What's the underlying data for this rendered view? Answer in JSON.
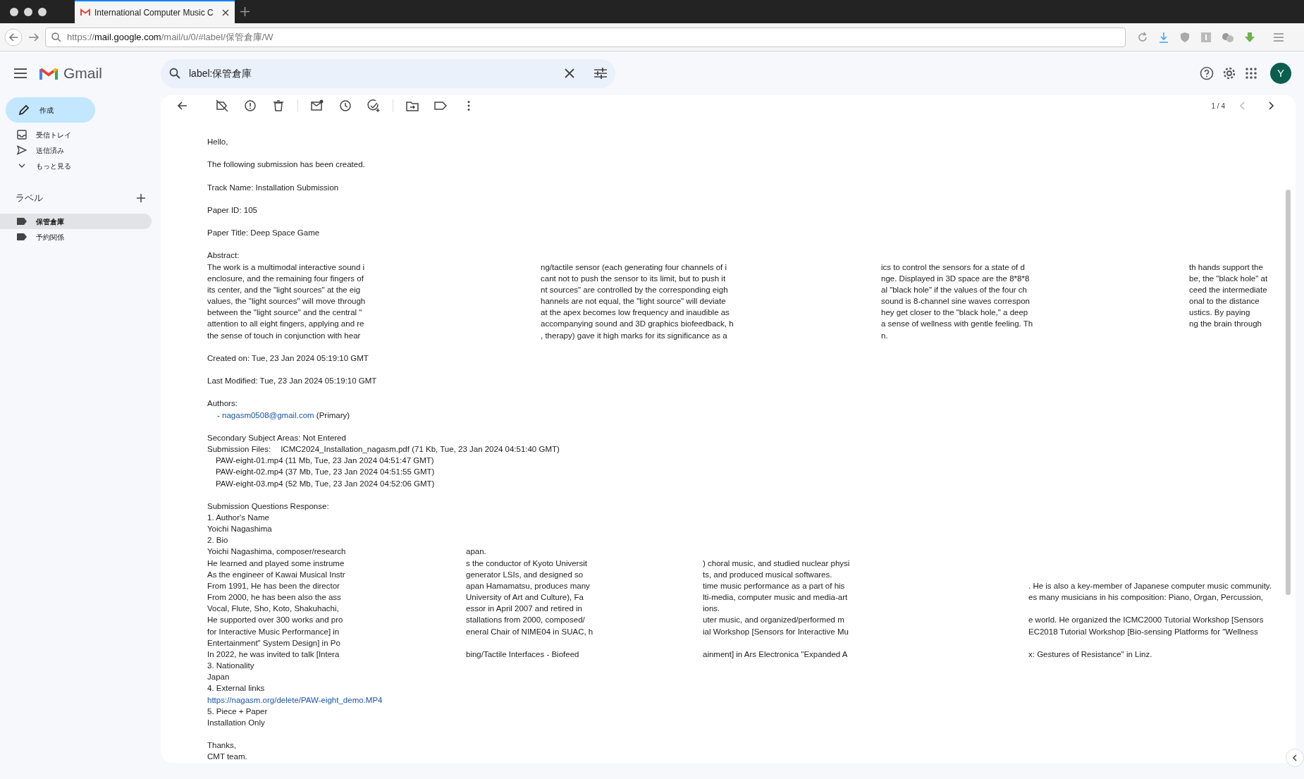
{
  "browser": {
    "tab_title": "International Computer Music C",
    "url": {
      "scheme": "https://",
      "host": "mail.google.com",
      "path": "/mail/u/0/#label/保管倉庫/W"
    }
  },
  "app": {
    "name": "Gmail",
    "search": {
      "value": "label:保管倉庫"
    },
    "avatar": "Y"
  },
  "sidebar": {
    "compose": "作成",
    "items": [
      {
        "label": "受信トレイ"
      },
      {
        "label": "送信済み"
      },
      {
        "label": "もっと見る"
      }
    ],
    "labels_heading": "ラベル",
    "labels": [
      {
        "label": "保管倉庫",
        "selected": true
      },
      {
        "label": "予約関係",
        "selected": false
      }
    ]
  },
  "toolbar": {
    "pagination": "1 / 4",
    "prev_disabled": true,
    "next_disabled": false
  },
  "message": {
    "paragraphs": [
      [
        {
          "kind": "text",
          "text": "Hello,"
        }
      ],
      [
        {
          "kind": "text",
          "text": "The following submission has been created."
        }
      ],
      [
        {
          "kind": "text",
          "text": "Track Name: Installation Submission"
        }
      ],
      [
        {
          "kind": "text",
          "text": "Paper ID: 105"
        }
      ],
      [
        {
          "kind": "text",
          "text": "Paper Title: Deep Space Game"
        }
      ],
      [
        {
          "kind": "text",
          "text": "Abstract:"
        },
        {
          "kind": "abstract_row",
          "cells": [
            "The work is a multimodal interactive sound i",
            "ng/tactile sensor (each generating four channels of i",
            "ics to control the sensors for a state of d",
            "th hands support the"
          ]
        },
        {
          "kind": "abstract_row",
          "cells": [
            "enclosure, and the remaining four fingers of",
            "cant not to push the sensor to its limit, but to push it",
            "nge. Displayed in 3D space are the 8*8*8",
            "be, the \"black hole\" at"
          ]
        },
        {
          "kind": "abstract_row",
          "cells": [
            "its center, and the \"light sources\" at the eig",
            "nt sources\" are controlled by the corresponding eigh",
            "al \"black hole\" if the values of the four ch",
            "ceed the intermediate"
          ]
        },
        {
          "kind": "abstract_row",
          "cells": [
            "values, the \"light sources\" will move through",
            "hannels are not equal, the \"light source\" will deviate",
            "sound is 8-channel sine waves correspon",
            "onal to the distance"
          ]
        },
        {
          "kind": "abstract_row",
          "cells": [
            "between the \"light source\" and the central \"",
            "at the apex becomes low frequency and inaudible as",
            "hey get closer to the \"black hole,\" a deep",
            "ustics. By paying"
          ]
        },
        {
          "kind": "abstract_row",
          "cells": [
            "attention to all eight fingers, applying and re",
            "accompanying sound and 3D graphics biofeedback, h",
            "a sense of wellness with gentle feeling. Th",
            "ng the brain through"
          ]
        },
        {
          "kind": "abstract_row",
          "cells": [
            "the sense of touch in conjunction with hear",
            ", therapy) gave it high marks for its significance as a",
            "n.",
            null
          ]
        }
      ],
      [
        {
          "kind": "text",
          "text": "Created on: Tue, 23 Jan 2024 05:19:10 GMT"
        }
      ],
      [
        {
          "kind": "text",
          "text": "Last Modified: Tue, 23 Jan 2024 05:19:10 GMT"
        }
      ],
      [
        {
          "kind": "text",
          "text": "Authors:"
        },
        {
          "kind": "author",
          "bullet": "-",
          "email": "nagasm0508@gmail.com",
          "role": "(Primary)"
        }
      ],
      [
        {
          "kind": "text",
          "text": "Secondary Subject Areas: Not Entered"
        },
        {
          "kind": "files",
          "label": "Submission Files:",
          "value": "ICMC2024_Installation_nagasm.pdf (71 Kb, Tue, 23 Jan 2024 04:51:40 GMT)"
        },
        {
          "kind": "indent",
          "text": "PAW-eight-01.mp4 (11 Mb, Tue, 23 Jan 2024 04:51:47 GMT)"
        },
        {
          "kind": "indent",
          "text": "PAW-eight-02.mp4 (37 Mb, Tue, 23 Jan 2024 04:51:55 GMT)"
        },
        {
          "kind": "indent",
          "text": "PAW-eight-03.mp4 (52 Mb, Tue, 23 Jan 2024 04:52:06 GMT)"
        }
      ],
      [
        {
          "kind": "text",
          "text": "Submission Questions Response:"
        },
        {
          "kind": "text",
          "text": "1. Author's Name"
        },
        {
          "kind": "text",
          "text": "Yoichi Nagashima"
        },
        {
          "kind": "text",
          "text": "2. Bio"
        },
        {
          "kind": "bio_row",
          "cells": [
            "Yoichi Nagashima, composer/research",
            "apan.",
            null,
            null
          ]
        },
        {
          "kind": "bio_row",
          "cells": [
            "He learned and played some instrume",
            "s the conductor of Kyoto Universit",
            ") choral music, and studied nuclear physi",
            null
          ]
        },
        {
          "kind": "bio_row",
          "cells": [
            "As the engineer of Kawai Musical Instr",
            "generator LSIs, and designed so",
            "ts, and produced musical softwares.",
            null
          ]
        },
        {
          "kind": "bio_row",
          "cells": [
            "From 1991, He has been the director",
            "apan Hamamatsu, produces many",
            "time music performance as a part of his",
            ". He is also a key-member of Japanese computer music community."
          ]
        },
        {
          "kind": "bio_row",
          "cells": [
            "From 2000, he has been also the ass",
            "University of Art and Culture), Fa",
            "lti-media, computer music and media-art",
            "es many musicians in his composition: Piano, Organ, Percussion,"
          ]
        },
        {
          "kind": "bio_row",
          "cells": [
            "Vocal, Flute, Sho, Koto, Shakuhachi,",
            "essor in April 2007 and retired in",
            "ions.",
            null
          ]
        },
        {
          "kind": "bio_row",
          "cells": [
            "He supported over 300 works and pro",
            "stallations from 2000, composed/",
            "uter music, and organized/performed m",
            "e world. He organized the ICMC2000 Tutorial Workshop [Sensors"
          ]
        },
        {
          "kind": "bio_row",
          "cells": [
            "for Interactive Music Performance] in",
            "eneral Chair of NIME04 in SUAC, h",
            "ial Workshop [Sensors for Interactive Mu",
            "EC2018 Tutorial Workshop [Bio-sensing Platforms for \"Wellness"
          ]
        },
        {
          "kind": "bio_row",
          "cells": [
            "Entertainment\" System Design] in Po",
            null,
            null,
            null
          ]
        },
        {
          "kind": "bio_row",
          "cells": [
            "In 2022, he was invited to talk [Intera",
            "bing/Tactile Interfaces - Biofeed",
            "ainment] in Ars Electronica \"Expanded A",
            "x: Gestures of Resistance\" in Linz."
          ]
        },
        {
          "kind": "text",
          "text": "3. Nationality"
        },
        {
          "kind": "text",
          "text": "Japan"
        },
        {
          "kind": "text",
          "text": "4. External links"
        },
        {
          "kind": "link",
          "text": "https://nagasm.org/delete/PAW-eight_demo.MP4"
        },
        {
          "kind": "text",
          "text": "5. Piece + Paper"
        },
        {
          "kind": "text",
          "text": "Installation Only"
        }
      ],
      [
        {
          "kind": "text",
          "text": "Thanks,"
        },
        {
          "kind": "text",
          "text": "CMT team."
        }
      ]
    ]
  }
}
